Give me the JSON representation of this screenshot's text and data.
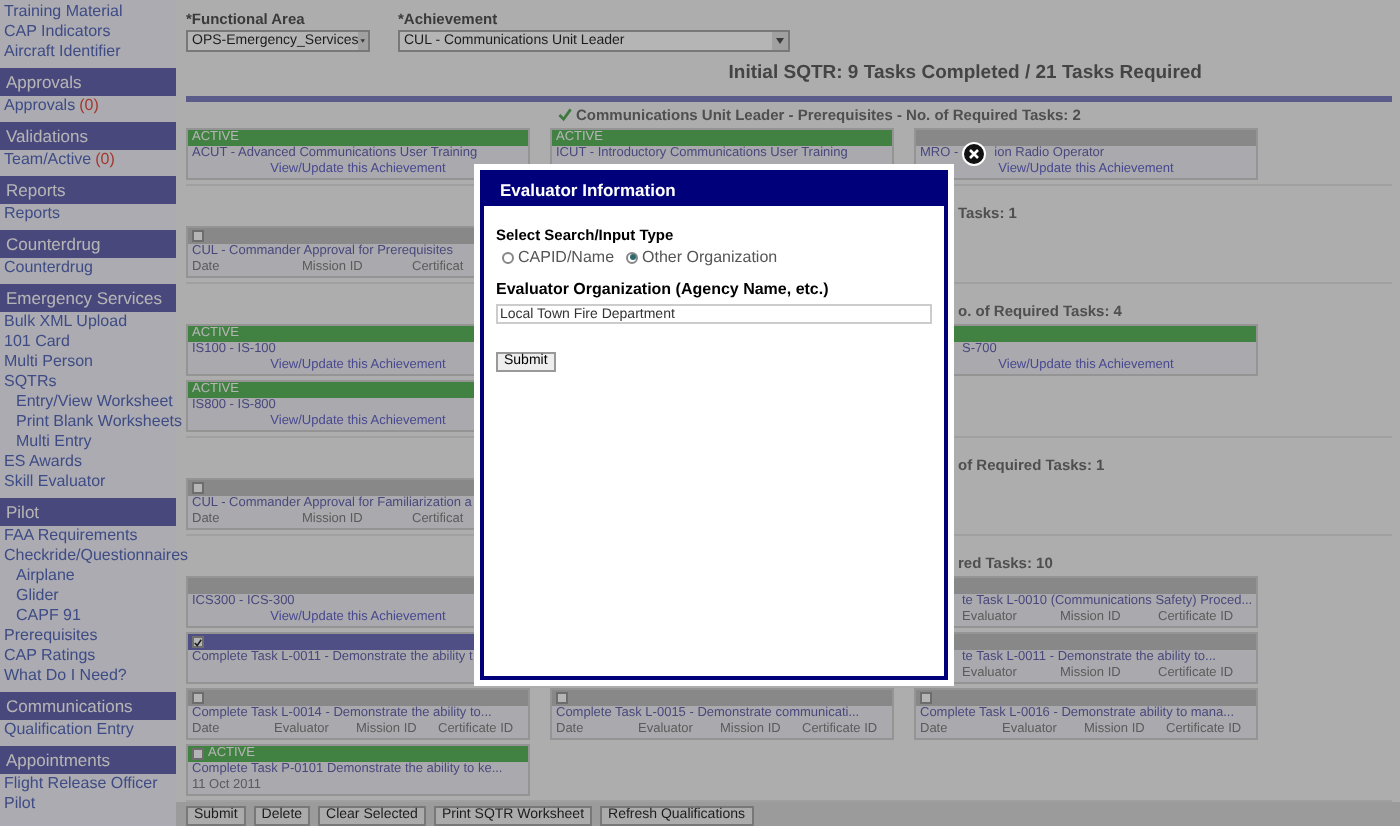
{
  "sidebar": [
    {
      "items": [
        {
          "label": "Training Material"
        },
        {
          "label": "CAP Indicators"
        },
        {
          "label": "Aircraft Identifier"
        }
      ]
    },
    {
      "heading": "Approvals",
      "items": [
        {
          "label": "Approvals",
          "count": "(0)"
        }
      ]
    },
    {
      "heading": "Validations",
      "items": [
        {
          "label": "Team/Active",
          "count": "(0)"
        }
      ]
    },
    {
      "heading": "Reports",
      "items": [
        {
          "label": "Reports"
        }
      ]
    },
    {
      "heading": "Counterdrug",
      "items": [
        {
          "label": "Counterdrug"
        }
      ]
    },
    {
      "heading": "Emergency Services",
      "items": [
        {
          "label": "Bulk XML Upload"
        },
        {
          "label": "101 Card"
        },
        {
          "label": "Multi Person"
        },
        {
          "label": "SQTRs",
          "children": [
            {
              "label": "Entry/View Worksheet"
            },
            {
              "label": "Print Blank Worksheets"
            },
            {
              "label": "Multi Entry"
            }
          ]
        },
        {
          "label": "ES Awards"
        },
        {
          "label": "Skill Evaluator"
        }
      ]
    },
    {
      "heading": "Pilot",
      "items": [
        {
          "label": "FAA Requirements"
        },
        {
          "label": "Checkride/Questionnaires",
          "children": [
            {
              "label": "Airplane"
            },
            {
              "label": "Glider"
            },
            {
              "label": "CAPF 91"
            }
          ]
        },
        {
          "label": "Prerequisites"
        },
        {
          "label": "CAP Ratings"
        },
        {
          "label": "What Do I Need?"
        }
      ]
    },
    {
      "heading": "Communications",
      "items": [
        {
          "label": "Qualification Entry"
        }
      ]
    },
    {
      "heading": "Appointments",
      "items": [
        {
          "label": "Flight Release Officer"
        },
        {
          "label": "Pilot"
        }
      ]
    }
  ],
  "filters": [
    {
      "label": "*Functional Area",
      "value": "OPS-Emergency_Services"
    },
    {
      "label": "*Achievement",
      "value": "CUL - Communications Unit Leader"
    }
  ],
  "summary": "Initial SQTR: 9 Tasks Completed / 21 Tasks Required",
  "sections": [
    {
      "heading": "Communications Unit Leader - Prerequisites - No. of Required Tasks: 2",
      "complete": true,
      "covered": false,
      "rows": [
        [
          {
            "active": true,
            "badge": "ACTIVE",
            "title": "ACUT - Advanced Communications User Training",
            "link": "View/Update this Achievement"
          },
          {
            "active": true,
            "badge": "ACTIVE",
            "title": "ICUT - Introductory Communications User Training"
          },
          {
            "active": false,
            "title": "MRO -",
            "title_rest": "ion Radio Operator",
            "link": "View/Update this Achievement"
          }
        ]
      ]
    },
    {
      "heading": "Tasks: 1",
      "covered": true,
      "rows": [
        [
          {
            "active": false,
            "checkbox": true,
            "checked": false,
            "title": "CUL - Commander Approval for Prerequisites",
            "fields": [
              "Date",
              "Mission ID",
              "Certificat"
            ]
          },
          null,
          null
        ]
      ]
    },
    {
      "heading": "o. of Required Tasks: 4",
      "covered": true,
      "rows": [
        [
          {
            "active": true,
            "badge": "ACTIVE",
            "title": "IS100 - IS-100",
            "link": "View/Update this Achievement"
          },
          null,
          {
            "active": true,
            "covered": true,
            "title": "S-700",
            "link": "View/Update this Achievement"
          }
        ],
        [
          {
            "active": true,
            "badge": "ACTIVE",
            "title": "IS800 - IS-800",
            "link": "View/Update this Achievement"
          },
          null,
          null
        ]
      ]
    },
    {
      "heading": "of Required Tasks: 1",
      "covered": true,
      "rows": [
        [
          {
            "active": false,
            "checkbox": true,
            "checked": false,
            "title": "CUL - Commander Approval for Familiarization a",
            "fields": [
              "Date",
              "Mission ID",
              "Certificat"
            ]
          },
          null,
          null
        ]
      ]
    },
    {
      "heading": "red Tasks: 10",
      "covered": true,
      "rows": [
        [
          {
            "active": false,
            "title": "ICS300 - ICS-300",
            "link": "View/Update this Achievement"
          },
          null,
          {
            "active": false,
            "covered": true,
            "title": "te Task L-0010 (Communications Safety) Proced...",
            "fields": [
              "Evaluator",
              "Mission ID",
              "Certificate ID"
            ]
          }
        ],
        [
          {
            "active": false,
            "checkbox": true,
            "checked": true,
            "title": "Complete Task L-0011 - Demonstrate the ability t"
          },
          null,
          {
            "active": false,
            "covered": true,
            "title": "te Task L-0011 - Demonstrate the ability to...",
            "fields": [
              "Evaluator",
              "Mission ID",
              "Certificate ID"
            ]
          }
        ],
        [
          {
            "active": false,
            "checkbox": true,
            "checked": false,
            "title": "Complete Task L-0014 - Demonstrate the ability to...",
            "fields": [
              "Date",
              "Evaluator",
              "Mission ID",
              "Certificate ID"
            ]
          },
          {
            "active": false,
            "checkbox": true,
            "checked": false,
            "title": "Complete Task L-0015 - Demonstrate communicati...",
            "fields": [
              "Date",
              "Evaluator",
              "Mission ID",
              "Certificate ID"
            ]
          },
          {
            "active": false,
            "checkbox": true,
            "checked": false,
            "title": "Complete Task L-0016 - Demonstrate ability to mana...",
            "fields": [
              "Date",
              "Evaluator",
              "Mission ID",
              "Certificate ID"
            ]
          }
        ],
        [
          {
            "active": true,
            "badge": "ACTIVE",
            "checkbox": true,
            "checked": false,
            "title": "Complete Task P-0101 Demonstrate the ability to ke...",
            "fields": [
              "11 Oct 2011"
            ]
          },
          null,
          null
        ]
      ]
    }
  ],
  "toolbar": [
    "Submit",
    "Delete",
    "Clear Selected",
    "Print SQTR Worksheet",
    "Refresh Qualifications"
  ],
  "dialog": {
    "title": "Evaluator Information",
    "search_label": "Select Search/Input Type",
    "options": [
      {
        "label": "CAPID/Name",
        "selected": false
      },
      {
        "label": "Other Organization",
        "selected": true
      }
    ],
    "field_label": "Evaluator Organization (Agency Name, etc.)",
    "field_value": "Local Town Fire Department",
    "submit": "Submit"
  }
}
